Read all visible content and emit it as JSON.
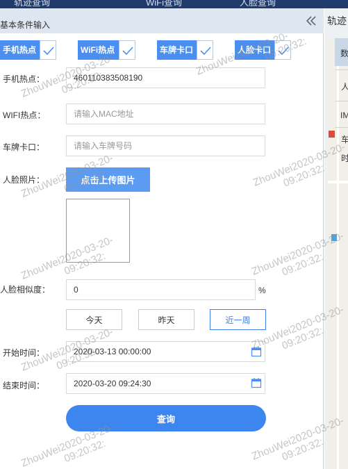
{
  "topnav": {
    "items": [
      "轨迹查询",
      "WiFi查询",
      "人脸查询"
    ]
  },
  "panel": {
    "title": "基本条件输入"
  },
  "chips": [
    {
      "label": "手机热点",
      "checked": true
    },
    {
      "label": "WiFi热点",
      "checked": true
    },
    {
      "label": "车牌卡口",
      "checked": true
    },
    {
      "label": "人脸卡口",
      "checked": true
    }
  ],
  "form": {
    "phone": {
      "label": "手机热点：",
      "value": "460110383508190"
    },
    "wifi": {
      "label": "WIFI热点：",
      "placeholder": "请输入MAC地址"
    },
    "plate": {
      "label": "车牌卡口：",
      "placeholder": "请输入车牌号码"
    },
    "face": {
      "label": "人脸照片：",
      "upload_label": "点击上传图片"
    },
    "similarity": {
      "label": "人脸相似度：",
      "value": "0",
      "unit": "%"
    },
    "date_buttons": [
      "今天",
      "昨天",
      "近一周"
    ],
    "date_selected": "近一周",
    "start": {
      "label": "开始时间：",
      "value": "2020-03-13 00:00:00"
    },
    "end": {
      "label": "结束时间：",
      "value": "2020-03-20 09:24:30"
    },
    "query_label": "查询"
  },
  "right": {
    "title": "轨迹",
    "rows": [
      "数",
      "人",
      "IM",
      "车",
      "时"
    ]
  },
  "watermark": {
    "line1": "ZhouWei2020-03-20-",
    "line2": "09:20:32:"
  },
  "colors": {
    "accent": "#3d86f0",
    "chip": "#4a8ef0",
    "header": "#dde6f1",
    "nav": "#1f3a6b"
  }
}
